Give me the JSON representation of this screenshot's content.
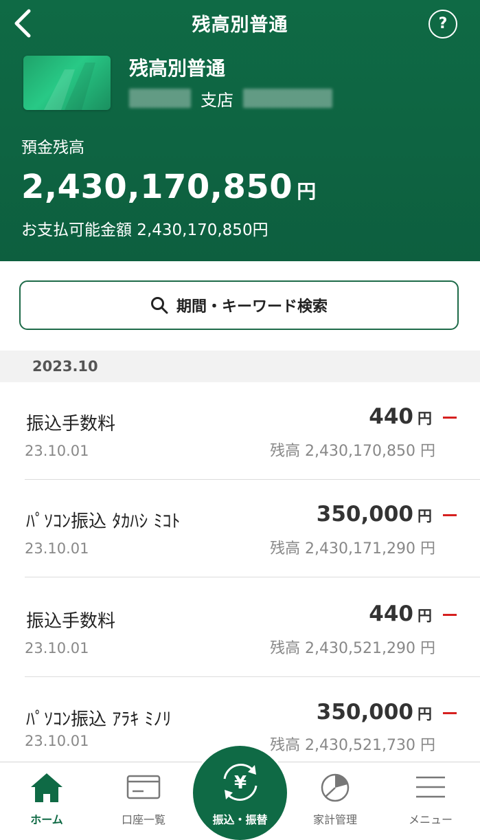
{
  "header": {
    "title": "残高別普通",
    "help_label": "?"
  },
  "account": {
    "name": "残高別普通",
    "branch_label": "支店",
    "balance_label": "預金残高",
    "balance": "2,430,170,850",
    "yen": "円",
    "available": "お支払可能金額 2,430,170,850円"
  },
  "search": {
    "label": "期間・キーワード検索"
  },
  "month": "2023.10",
  "transactions": [
    {
      "desc": "振込手数料",
      "date": "23.10.01",
      "amount": "440",
      "yen": "円",
      "balance": "残高 2,430,170,850 円"
    },
    {
      "desc": "ﾊﾟｿｺﾝ振込 ﾀｶﾊｼ ﾐｺﾄ",
      "date": "23.10.01",
      "amount": "350,000",
      "yen": "円",
      "balance": "残高 2,430,171,290 円"
    },
    {
      "desc": "振込手数料",
      "date": "23.10.01",
      "amount": "440",
      "yen": "円",
      "balance": "残高 2,430,521,290 円"
    },
    {
      "desc": "ﾊﾟｿｺﾝ振込 ｱﾗｷ ﾐﾉﾘ",
      "date": "23.10.01",
      "amount": "350,000",
      "yen": "円",
      "balance": "残高 2,430,521,730 円"
    }
  ],
  "tabbar": {
    "home": "ホーム",
    "accounts": "口座一覧",
    "transfer": "振込・振替",
    "budget": "家計管理",
    "menu": "メニュー"
  },
  "colors": {
    "brand_green": "#0f6a45",
    "debit_red": "#d6201f"
  },
  "icons": [
    "back-chevron-icon",
    "help-icon",
    "search-icon",
    "home-icon",
    "card-icon",
    "yen-transfer-icon",
    "pie-chart-icon",
    "hamburger-menu-icon"
  ]
}
